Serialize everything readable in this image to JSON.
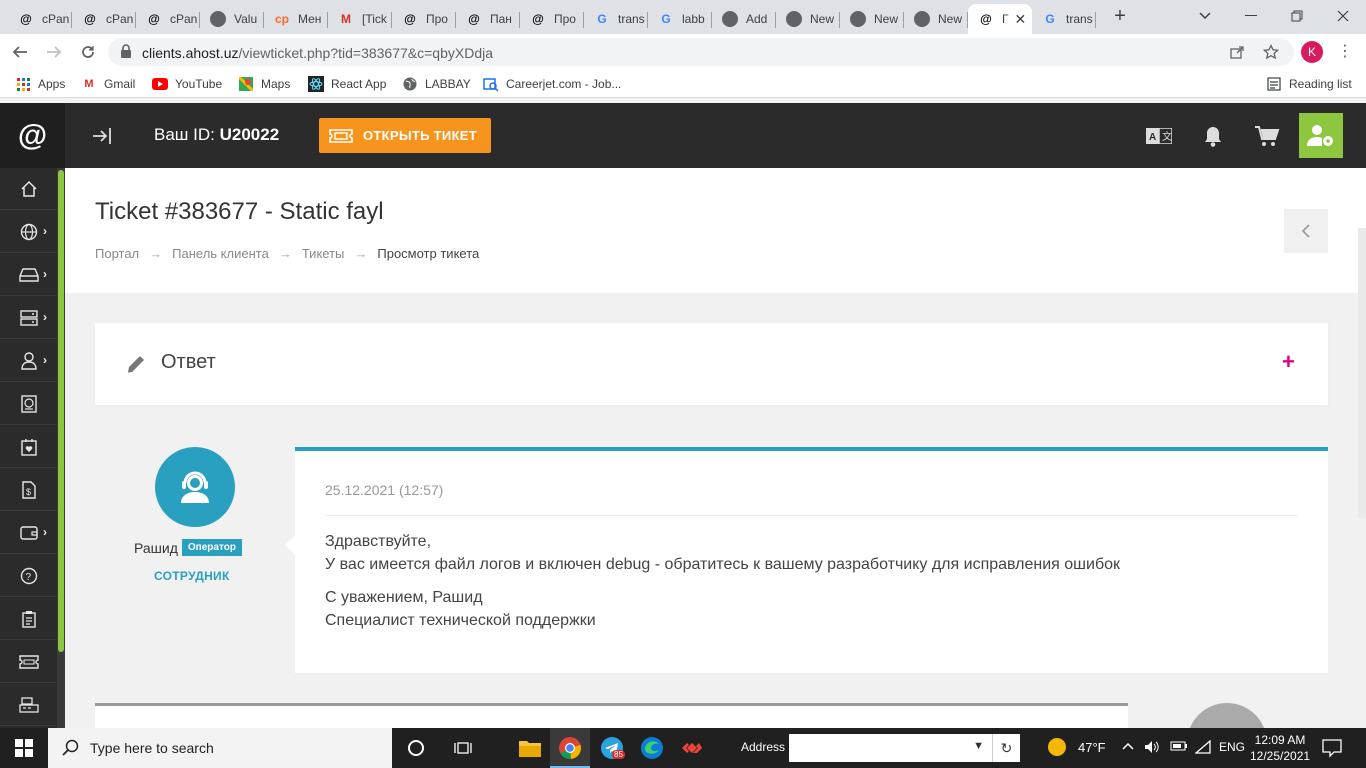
{
  "browser": {
    "tabs": [
      {
        "label": "cPan",
        "favicon": "at-icon"
      },
      {
        "label": "cPan",
        "favicon": "at-icon"
      },
      {
        "label": "cPan",
        "favicon": "at-icon"
      },
      {
        "label": "Valu",
        "favicon": "globe-icon"
      },
      {
        "label": "Мен",
        "favicon": "cp-icon"
      },
      {
        "label": "[Tick",
        "favicon": "gmail-icon"
      },
      {
        "label": "Про",
        "favicon": "at-icon"
      },
      {
        "label": "Пан",
        "favicon": "at-icon"
      },
      {
        "label": "Про",
        "favicon": "at-icon"
      },
      {
        "label": "trans",
        "favicon": "google-icon"
      },
      {
        "label": "labb",
        "favicon": "google-icon"
      },
      {
        "label": "Add",
        "favicon": "globe-icon"
      },
      {
        "label": "New",
        "favicon": "chrome-icon"
      },
      {
        "label": "New",
        "favicon": "chrome-icon"
      },
      {
        "label": "New",
        "favicon": "chrome-icon"
      },
      {
        "label": "Г",
        "favicon": "at-icon",
        "active": true
      },
      {
        "label": "trans",
        "favicon": "google-icon"
      }
    ],
    "url_host": "clients.ahost.uz",
    "url_path": "/viewticket.php?tid=383677&c=qbyXDdja",
    "profile_initial": "K",
    "bookmarks": [
      {
        "label": "Apps"
      },
      {
        "label": "Gmail"
      },
      {
        "label": "YouTube"
      },
      {
        "label": "Maps"
      },
      {
        "label": "React App"
      },
      {
        "label": "LABBAY"
      },
      {
        "label": "Careerjet.com - Job..."
      }
    ],
    "reading_list": "Reading list"
  },
  "header": {
    "logo": "@",
    "id_label": "Ваш ID:",
    "id_value": "U20022",
    "open_ticket": "ОТКРЫТЬ ТИКЕТ"
  },
  "page": {
    "title": "Ticket #383677 - Static fayl",
    "breadcrumb": [
      "Портал",
      "Панель клиента",
      "Тикеты",
      "Просмотр тикета"
    ],
    "reply_title": "Ответ",
    "reply_toggle": "+"
  },
  "message": {
    "author": "Рашид",
    "role_badge": "Оператор",
    "author_type": "СОТРУДНИК",
    "date": "25.12.2021 (12:57)",
    "lines": [
      "Здравствуйте,",
      "У вас имеется файл логов и включен debug - обратитесь к вашему разработчику для исправления ошибок",
      "С уважением, Рашид",
      "Специалист технической поддержки"
    ]
  },
  "taskbar": {
    "search_placeholder": "Type here to search",
    "telegram_badge": "85",
    "address_label": "Address",
    "weather": "47°F",
    "language": "ENG",
    "time": "12:09 AM",
    "date": "12/25/2021"
  },
  "colors": {
    "accent_orange": "#f7941d",
    "accent_green": "#8dc63f",
    "accent_blue": "#2aa0c1",
    "accent_pink": "#e4007c",
    "dark": "#2b2b2b"
  }
}
